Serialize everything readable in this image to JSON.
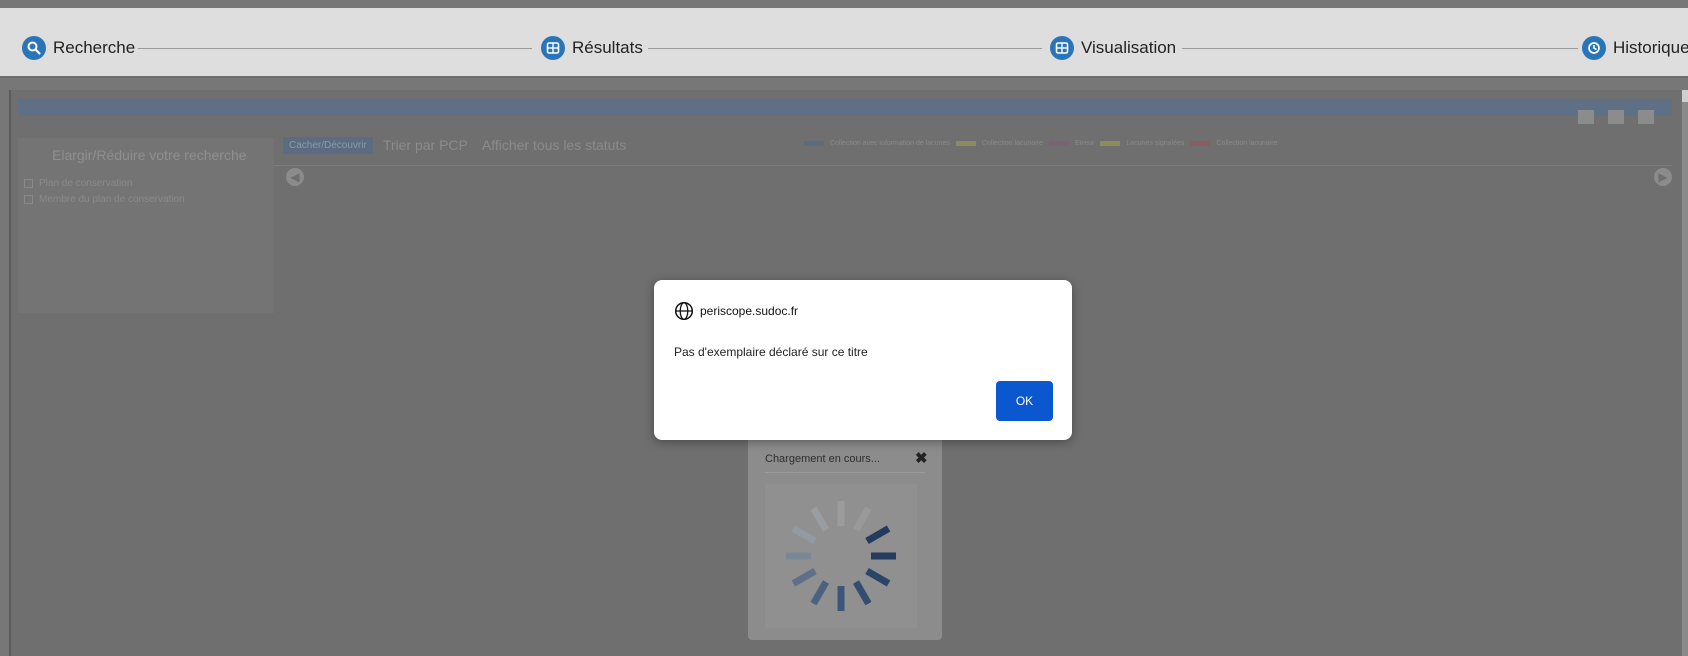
{
  "steps": [
    {
      "label": "Recherche",
      "icon": "search-icon"
    },
    {
      "label": "Résultats",
      "icon": "table-icon"
    },
    {
      "label": "Visualisation",
      "icon": "table-icon"
    },
    {
      "label": "Historique",
      "icon": "history-icon"
    }
  ],
  "background": {
    "side_title": "Elargir/Réduire votre recherche",
    "options": [
      "Plan de conservation",
      "Membre du plan de conservation"
    ],
    "filter_button": "Cacher/Découvrir",
    "sort_select": "Trier par PCP",
    "status_select": "Afficher tous les statuts",
    "legend": [
      {
        "label": "Collection avec information de lacunes",
        "color": "#5d6b7e"
      },
      {
        "label": "Collection lacunaire",
        "color": "#8d8a5e"
      },
      {
        "label": "Erreur",
        "color": "#7a6277"
      },
      {
        "label": "Lacunes signalées",
        "color": "#8d8c5c"
      },
      {
        "label": "Collection lacunaire",
        "color": "#8b5d63"
      }
    ]
  },
  "loading": {
    "title": "Chargement en cours...",
    "close_glyph": "✖"
  },
  "dialog": {
    "origin": "periscope.sudoc.fr",
    "message": "Pas d'exemplaire déclaré sur ce titre",
    "ok_label": "OK"
  },
  "colors": {
    "accent": "#2a74b8",
    "ok_button": "#0b57d0"
  }
}
